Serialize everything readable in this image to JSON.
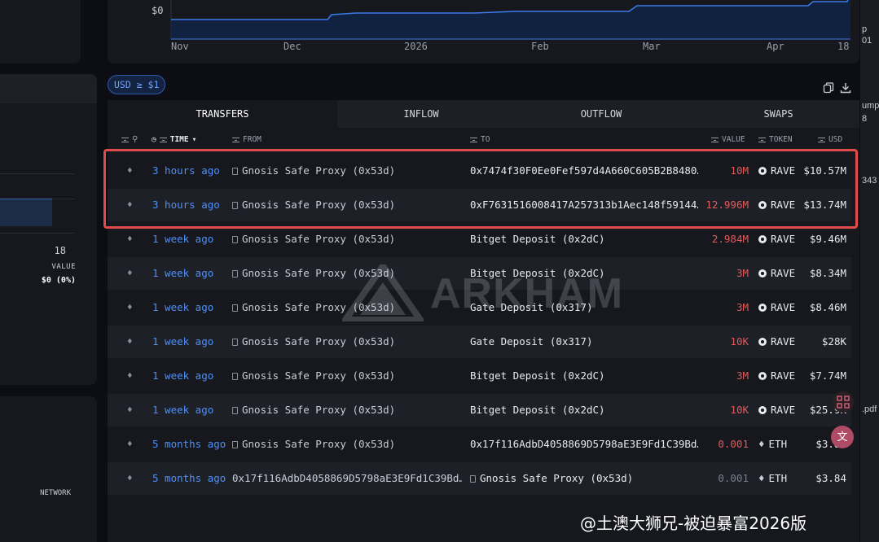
{
  "chart": {
    "y_label": "$0",
    "x_ticks": [
      "Nov",
      "Dec",
      "2026",
      "Feb",
      "Mar",
      "Apr",
      "18"
    ]
  },
  "left_panel": {
    "tick": "18",
    "value_label": "VALUE",
    "value": "$0 (0%)",
    "network_label": "NETWORK"
  },
  "filter_chip": "USD ≥ $1",
  "tabs": [
    "TRANSFERS",
    "INFLOW",
    "OUTFLOW",
    "SWAPS"
  ],
  "columns": {
    "time": "TIME",
    "from": "FROM",
    "to": "TO",
    "value": "VALUE",
    "token": "TOKEN",
    "usd": "USD"
  },
  "rows": [
    {
      "time": "3 hours ago",
      "from": "Gnosis Safe Proxy (0x53d)",
      "to": "0x7474f30F0Ee0Fef597d4A660C605B2B8480…",
      "value": "10M",
      "token": "RAVE",
      "usd": "$10.57M"
    },
    {
      "time": "3 hours ago",
      "from": "Gnosis Safe Proxy (0x53d)",
      "to": "0xF7631516008417A257313b1Aec148f59144…",
      "value": "12.996M",
      "token": "RAVE",
      "usd": "$13.74M"
    },
    {
      "time": "1 week ago",
      "from": "Gnosis Safe Proxy (0x53d)",
      "to": "Bitget Deposit (0x2dC)",
      "value": "2.984M",
      "token": "RAVE",
      "usd": "$9.46M"
    },
    {
      "time": "1 week ago",
      "from": "Gnosis Safe Proxy (0x53d)",
      "to": "Bitget Deposit (0x2dC)",
      "value": "3M",
      "token": "RAVE",
      "usd": "$8.34M"
    },
    {
      "time": "1 week ago",
      "from": "Gnosis Safe Proxy (0x53d)",
      "to": "Gate Deposit (0x317)",
      "value": "3M",
      "token": "RAVE",
      "usd": "$8.46M"
    },
    {
      "time": "1 week ago",
      "from": "Gnosis Safe Proxy (0x53d)",
      "to": "Gate Deposit (0x317)",
      "value": "10K",
      "token": "RAVE",
      "usd": "$28K"
    },
    {
      "time": "1 week ago",
      "from": "Gnosis Safe Proxy (0x53d)",
      "to": "Bitget Deposit (0x2dC)",
      "value": "3M",
      "token": "RAVE",
      "usd": "$7.74M"
    },
    {
      "time": "1 week ago",
      "from": "Gnosis Safe Proxy (0x53d)",
      "to": "Bitget Deposit (0x2dC)",
      "value": "10K",
      "token": "RAVE",
      "usd": "$25.9K"
    },
    {
      "time": "5 months ago",
      "from": "Gnosis Safe Proxy (0x53d)",
      "to": "0x17f116AdbD4058869D5798aE3E9Fd1C39Bd…",
      "value": "0.001",
      "token": "ETH",
      "usd": "$3.84"
    },
    {
      "time": "5 months ago",
      "from": "0x17f116AdbD4058869D5798aE3E9Fd1C39Bd…",
      "to": "Gnosis Safe Proxy (0x53d)",
      "value": "0.001",
      "token": "ETH",
      "usd": "$3.84"
    }
  ],
  "watermark": "ARKHAM",
  "right_edge": [
    "p",
    "01",
    "ump",
    "8",
    "343",
    ".pdf"
  ],
  "credit": "@土澳大狮兄-被迫暴富2026版",
  "colors": {
    "accent": "#4f8ff7",
    "value_red": "#e05a5a",
    "highlight": "#e04b4b"
  }
}
